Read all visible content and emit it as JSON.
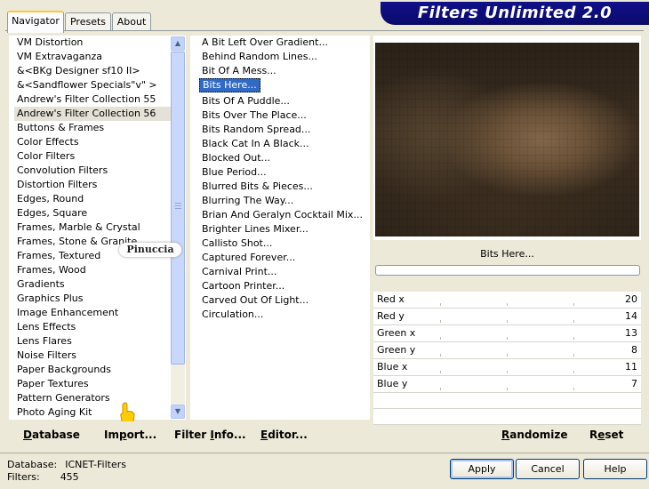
{
  "tabs": [
    {
      "label": "Navigator",
      "active": true
    },
    {
      "label": "Presets",
      "active": false
    },
    {
      "label": "About",
      "active": false
    }
  ],
  "brand_title": "Filters Unlimited 2.0",
  "categories": [
    "VM Distortion",
    "VM Extravaganza",
    "&<BKg Designer sf10 II>",
    "&<Sandflower Specials\"v\" >",
    "Andrew's Filter Collection 55",
    "Andrew's Filter Collection 56",
    "Buttons & Frames",
    "Color Effects",
    "Color Filters",
    "Convolution Filters",
    "Distortion Filters",
    "Edges, Round",
    "Edges, Square",
    "Frames, Marble & Crystal",
    "Frames, Stone & Granite",
    "Frames, Textured",
    "Frames, Wood",
    "Gradients",
    "Graphics Plus",
    "Image Enhancement",
    "Lens Effects",
    "Lens Flares",
    "Noise Filters",
    "Paper Backgrounds",
    "Paper Textures",
    "Pattern Generators",
    "Photo Aging Kit"
  ],
  "selected_category": "Andrew's Filter Collection 56",
  "filters": [
    "A Bit Left Over Gradient...",
    "Behind Random Lines...",
    "Bit Of A Mess...",
    "Bits Here...",
    "Bits Of A Puddle...",
    "Bits Over The Place...",
    "Bits Random Spread...",
    "Black Cat In A Black...",
    "Blocked Out...",
    "Blue Period...",
    "Blurred Bits & Pieces...",
    "Blurring The Way...",
    "Brian And Geralyn Cocktail Mix...",
    "Brighter Lines Mixer...",
    "Callisto Shot...",
    "Captured Forever...",
    "Carnival Print...",
    "Cartoon Printer...",
    "Carved Out Of Light...",
    "Circulation..."
  ],
  "selected_filter": "Bits Here...",
  "preview_filter_name": "Bits Here...",
  "params": [
    {
      "label": "Red x",
      "value": "20"
    },
    {
      "label": "Red y",
      "value": "14"
    },
    {
      "label": "Green x",
      "value": "13"
    },
    {
      "label": "Green y",
      "value": "8"
    },
    {
      "label": "Blue x",
      "value": "11"
    },
    {
      "label": "Blue y",
      "value": "7"
    }
  ],
  "toolbar": {
    "database": {
      "u": "D",
      "rest": "atabase"
    },
    "import": {
      "pre": "Im",
      "u": "p",
      "rest": "ort..."
    },
    "filter_info": {
      "pre": "Filter ",
      "u": "I",
      "rest": "nfo..."
    },
    "editor": {
      "u": "E",
      "rest": "ditor..."
    },
    "randomize": {
      "u": "R",
      "rest": "andomize"
    },
    "reset": {
      "pre": "R",
      "u": "e",
      "rest": "set"
    }
  },
  "status": {
    "database_label": "Database:",
    "database_value": "ICNET-Filters",
    "filters_label": "Filters:",
    "filters_value": "455"
  },
  "buttons": {
    "apply": "Apply",
    "cancel": "Cancel",
    "help": "Help"
  },
  "watermark": "Pinuccia"
}
